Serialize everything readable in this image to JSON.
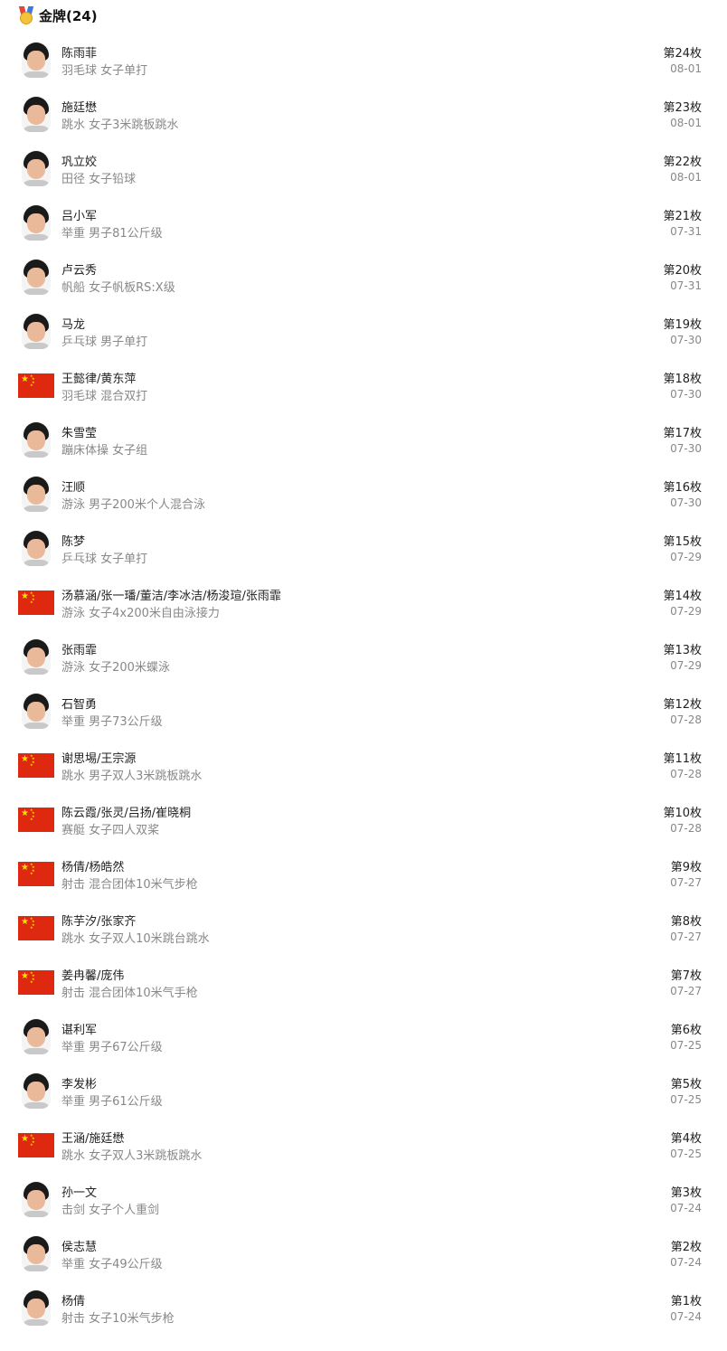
{
  "header": {
    "icon": "gold-medal-icon",
    "title": "金牌(24)"
  },
  "medals": [
    {
      "name": "陈雨菲",
      "event": "羽毛球 女子单打",
      "rank": "第24枚",
      "date": "08-01",
      "icon": "athlete-photo"
    },
    {
      "name": "施廷懋",
      "event": "跳水 女子3米跳板跳水",
      "rank": "第23枚",
      "date": "08-01",
      "icon": "athlete-photo"
    },
    {
      "name": "巩立姣",
      "event": "田径 女子铅球",
      "rank": "第22枚",
      "date": "08-01",
      "icon": "athlete-photo"
    },
    {
      "name": "吕小军",
      "event": "举重 男子81公斤级",
      "rank": "第21枚",
      "date": "07-31",
      "icon": "athlete-photo"
    },
    {
      "name": "卢云秀",
      "event": "帆船 女子帆板RS:X级",
      "rank": "第20枚",
      "date": "07-31",
      "icon": "athlete-photo"
    },
    {
      "name": "马龙",
      "event": "乒乓球 男子单打",
      "rank": "第19枚",
      "date": "07-30",
      "icon": "athlete-photo"
    },
    {
      "name": "王懿律/黄东萍",
      "event": "羽毛球 混合双打",
      "rank": "第18枚",
      "date": "07-30",
      "icon": "china-flag"
    },
    {
      "name": "朱雪莹",
      "event": "蹦床体操 女子组",
      "rank": "第17枚",
      "date": "07-30",
      "icon": "athlete-photo"
    },
    {
      "name": "汪顺",
      "event": "游泳 男子200米个人混合泳",
      "rank": "第16枚",
      "date": "07-30",
      "icon": "athlete-photo"
    },
    {
      "name": "陈梦",
      "event": "乒乓球 女子单打",
      "rank": "第15枚",
      "date": "07-29",
      "icon": "athlete-photo"
    },
    {
      "name": "汤慕涵/张一璠/董洁/李冰洁/杨浚瑄/张雨霏",
      "event": "游泳 女子4x200米自由泳接力",
      "rank": "第14枚",
      "date": "07-29",
      "icon": "china-flag"
    },
    {
      "name": "张雨霏",
      "event": "游泳 女子200米蝶泳",
      "rank": "第13枚",
      "date": "07-29",
      "icon": "athlete-photo"
    },
    {
      "name": "石智勇",
      "event": "举重 男子73公斤级",
      "rank": "第12枚",
      "date": "07-28",
      "icon": "athlete-photo"
    },
    {
      "name": "谢思埸/王宗源",
      "event": "跳水 男子双人3米跳板跳水",
      "rank": "第11枚",
      "date": "07-28",
      "icon": "china-flag"
    },
    {
      "name": "陈云霞/张灵/吕扬/崔晓桐",
      "event": "赛艇 女子四人双桨",
      "rank": "第10枚",
      "date": "07-28",
      "icon": "china-flag"
    },
    {
      "name": "杨倩/杨皓然",
      "event": "射击 混合团体10米气步枪",
      "rank": "第9枚",
      "date": "07-27",
      "icon": "china-flag"
    },
    {
      "name": "陈芋汐/张家齐",
      "event": "跳水 女子双人10米跳台跳水",
      "rank": "第8枚",
      "date": "07-27",
      "icon": "china-flag"
    },
    {
      "name": "姜冉馨/庞伟",
      "event": "射击 混合团体10米气手枪",
      "rank": "第7枚",
      "date": "07-27",
      "icon": "china-flag"
    },
    {
      "name": "谌利军",
      "event": "举重 男子67公斤级",
      "rank": "第6枚",
      "date": "07-25",
      "icon": "athlete-photo"
    },
    {
      "name": "李发彬",
      "event": "举重 男子61公斤级",
      "rank": "第5枚",
      "date": "07-25",
      "icon": "athlete-photo"
    },
    {
      "name": "王涵/施廷懋",
      "event": "跳水 女子双人3米跳板跳水",
      "rank": "第4枚",
      "date": "07-25",
      "icon": "china-flag"
    },
    {
      "name": "孙一文",
      "event": "击剑 女子个人重剑",
      "rank": "第3枚",
      "date": "07-24",
      "icon": "athlete-photo"
    },
    {
      "name": "侯志慧",
      "event": "举重 女子49公斤级",
      "rank": "第2枚",
      "date": "07-24",
      "icon": "athlete-photo"
    },
    {
      "name": "杨倩",
      "event": "射击 女子10米气步枪",
      "rank": "第1枚",
      "date": "07-24",
      "icon": "athlete-photo"
    }
  ]
}
